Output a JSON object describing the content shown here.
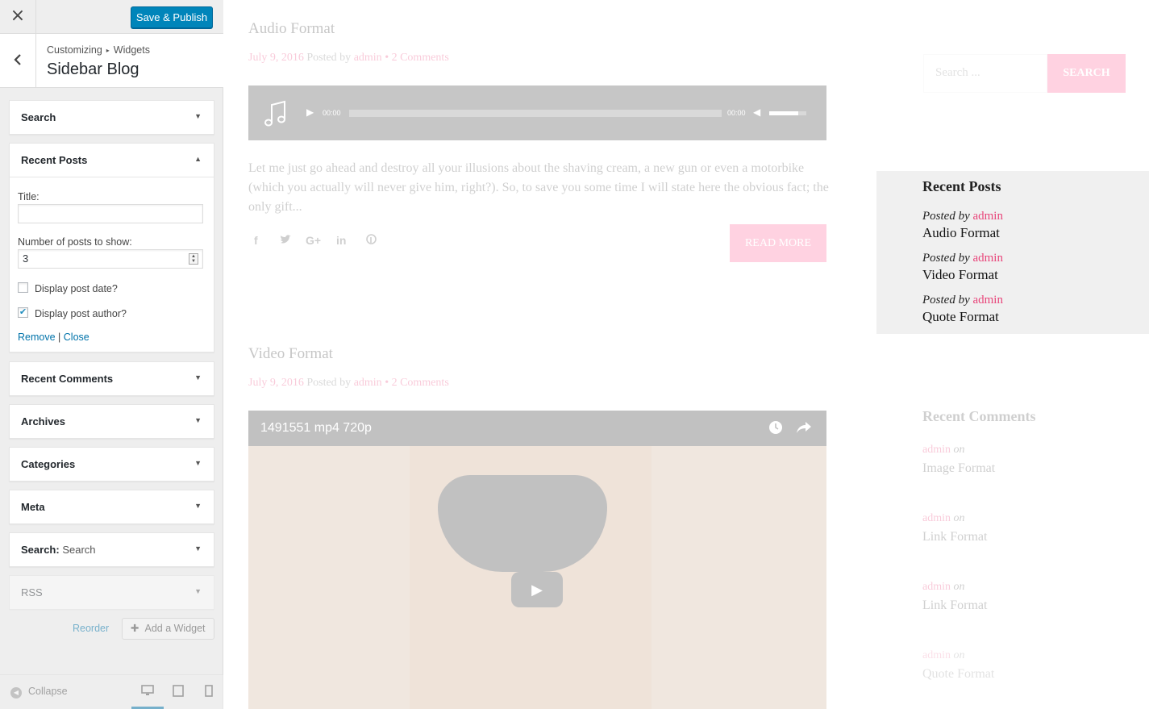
{
  "customizer": {
    "close_icon": "×",
    "save_label": "Save & Publish",
    "back_icon": "‹",
    "breadcrumb_root": "Customizing",
    "breadcrumb_sep": "▸",
    "breadcrumb_child": "Widgets",
    "section_title": "Sidebar Blog",
    "widgets": [
      {
        "title": "Search",
        "sub": ""
      },
      {
        "title": "Recent Posts",
        "sub": ""
      },
      {
        "title": "Recent Comments",
        "sub": ""
      },
      {
        "title": "Archives",
        "sub": ""
      },
      {
        "title": "Categories",
        "sub": ""
      },
      {
        "title": "Meta",
        "sub": ""
      },
      {
        "title": "Search:",
        "sub": "Search"
      },
      {
        "title": "RSS",
        "sub": ""
      }
    ],
    "recent_posts_form": {
      "title_label": "Title:",
      "title_value": "",
      "number_label": "Number of posts to show:",
      "number_value": "3",
      "show_date_label": "Display post date?",
      "show_date_checked": false,
      "show_author_label": "Display post author?",
      "show_author_checked": true,
      "remove_label": "Remove",
      "separator": "|",
      "close_label": "Close"
    },
    "reorder_label": "Reorder",
    "add_widget_label": "Add a Widget",
    "collapse_label": "Collapse"
  },
  "preview": {
    "post1": {
      "title": "Audio Format",
      "date": "July 9, 2016",
      "posted_by": "Posted by",
      "author": "admin",
      "comments": "2 Comments",
      "time_start": "00:00",
      "time_end": "00:00",
      "excerpt": "Let me just go ahead and destroy all your illusions about the shaving cream, a new gun or even a motorbike (which you actually will never give him, right?). So, to save you some time I will state here the obvious fact; the only gift...",
      "read_more": "READ MORE"
    },
    "post2": {
      "title": "Video Format",
      "date": "July 9, 2016",
      "posted_by": "Posted by",
      "author": "admin",
      "comments": "2 Comments",
      "video_title": "1491551 mp4 720p"
    },
    "sidebar": {
      "search_placeholder": "Search ...",
      "search_button": "SEARCH",
      "recent_posts_title": "Recent Posts",
      "recent_posts": [
        {
          "by": "Posted by",
          "author": "admin",
          "title": "Audio Format"
        },
        {
          "by": "Posted by",
          "author": "admin",
          "title": "Video Format"
        },
        {
          "by": "Posted by",
          "author": "admin",
          "title": "Quote Format"
        }
      ],
      "recent_comments_title": "Recent Comments",
      "recent_comments": [
        {
          "author": "admin",
          "on": "on",
          "post": "Image Format"
        },
        {
          "author": "admin",
          "on": "on",
          "post": "Link Format"
        },
        {
          "author": "admin",
          "on": "on",
          "post": "Link Format"
        },
        {
          "author": "admin",
          "on": "on",
          "post": "Quote Format"
        }
      ]
    }
  },
  "colors": {
    "accent": "#0085ba",
    "pink": "#e8457a",
    "button_pink": "#ff5e92"
  }
}
